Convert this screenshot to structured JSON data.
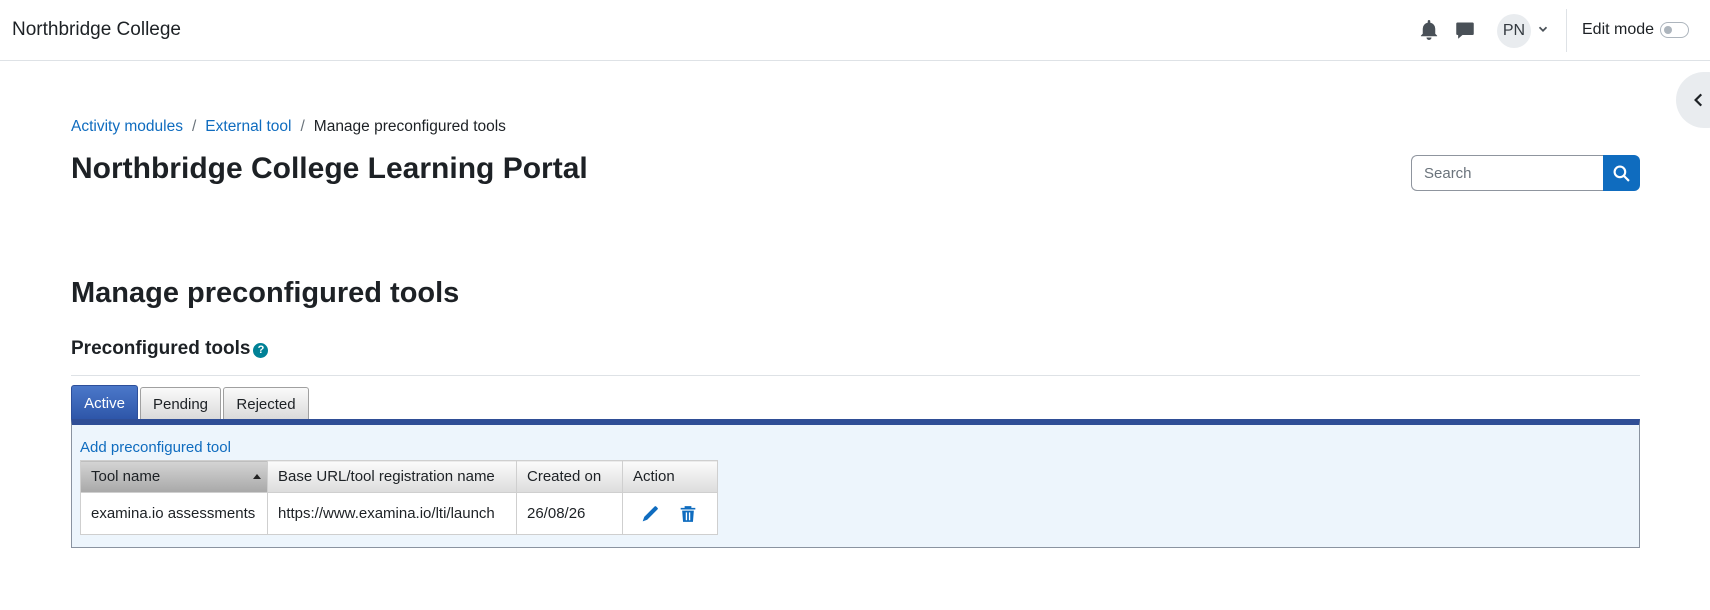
{
  "navbar": {
    "brand": "Northbridge College",
    "avatar_initials": "PN",
    "edit_mode_label": "Edit mode",
    "edit_mode_on": false,
    "icons": [
      "bell-icon",
      "chat-icon",
      "chevron-down-icon"
    ]
  },
  "breadcrumb": {
    "items": [
      {
        "label": "Activity modules",
        "link": true
      },
      {
        "label": "External tool",
        "link": true
      },
      {
        "label": "Manage preconfigured tools",
        "link": false
      }
    ],
    "separator": "/"
  },
  "page_title": "Northbridge College Learning Portal",
  "search": {
    "placeholder": "Search",
    "icon": "search-icon"
  },
  "main": {
    "heading": "Manage preconfigured tools",
    "section_title": "Preconfigured tools",
    "help_icon_glyph": "?",
    "tabs": [
      {
        "label": "Active",
        "active": true
      },
      {
        "label": "Pending",
        "active": false
      },
      {
        "label": "Rejected",
        "active": false
      }
    ],
    "add_link": "Add preconfigured tool",
    "table": {
      "columns": [
        "Tool name",
        "Base URL/tool registration name",
        "Created on",
        "Action"
      ],
      "sorted_column": "Tool name",
      "rows": [
        {
          "tool_name": "examina.io assessments",
          "base_url": "https://www.examina.io/lti/launch",
          "created_on": "26/08/26",
          "actions": [
            "edit-icon",
            "trash-icon"
          ]
        }
      ]
    }
  },
  "colors": {
    "link": "#0f6cbf",
    "active_tab": "#2d55a8",
    "panel_bg": "#edf5fc",
    "help_icon": "#008196"
  }
}
